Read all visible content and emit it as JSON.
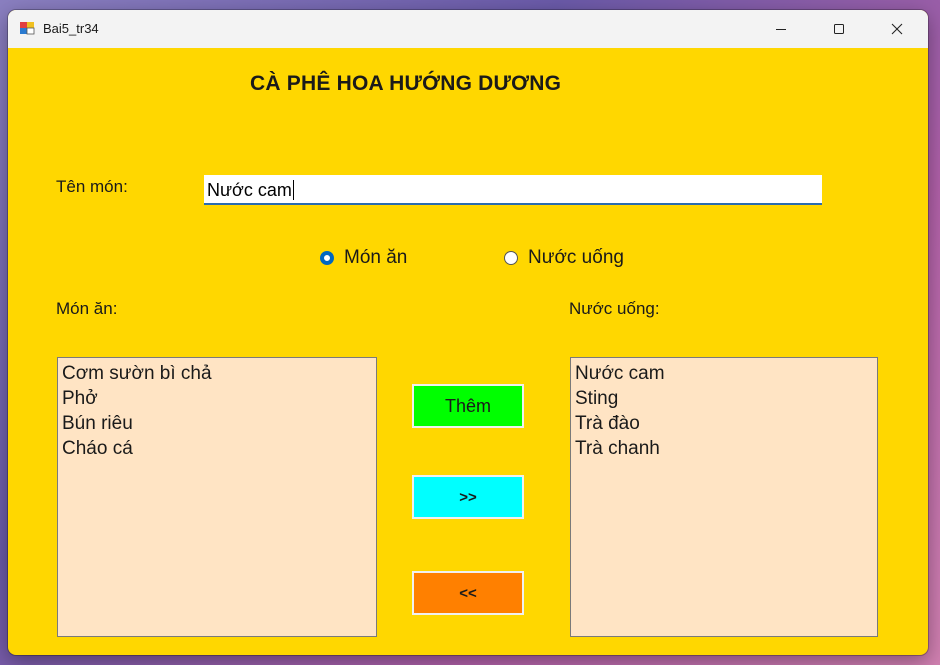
{
  "window": {
    "title": "Bai5_tr34"
  },
  "heading": "CÀ PHÊ HOA HƯỚNG DƯƠNG",
  "form": {
    "name_label": "Tên món:",
    "name_value": "Nước cam",
    "radio_food": "Món ăn",
    "radio_drink": "Nước uống",
    "selected": "Món ăn"
  },
  "food": {
    "label": "Món ăn:",
    "items": [
      "Cơm sườn bì chả",
      "Phở",
      "Bún riêu",
      "Cháo cá"
    ]
  },
  "drinks": {
    "label": "Nước uống:",
    "items": [
      "Nước cam",
      "Sting",
      "Trà đào",
      "Trà chanh"
    ]
  },
  "buttons": {
    "add": "Thêm",
    "move_right": ">>",
    "move_left": "<<"
  },
  "colors": {
    "background": "#ffd700",
    "listbox": "#ffe4c4",
    "add_button": "#00ff00",
    "move_right_button": "#00ffff",
    "move_left_button": "#ff8000"
  }
}
